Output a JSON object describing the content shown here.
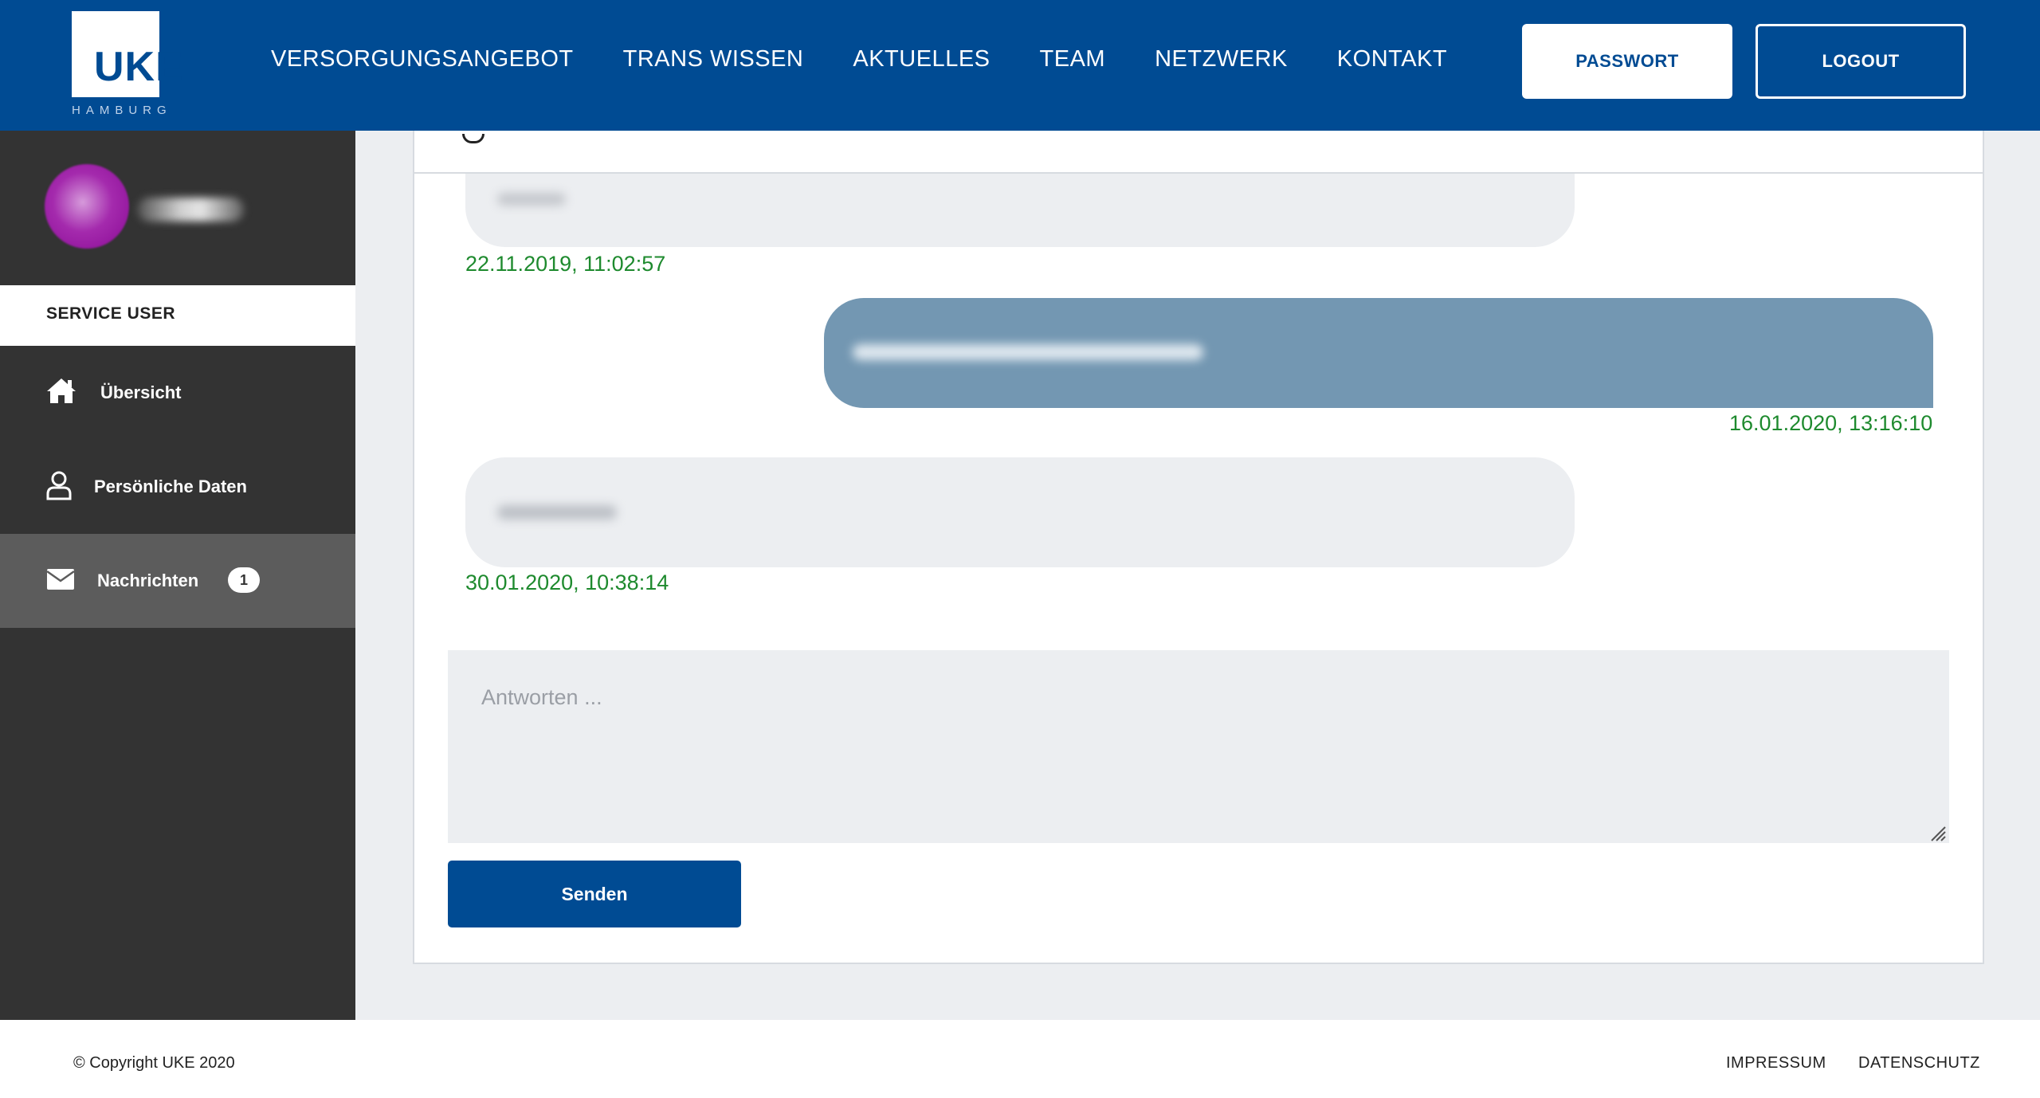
{
  "header": {
    "logo_text": "UKE",
    "logo_sub": "HAMBURG",
    "nav": [
      "VERSORGUNGSANGEBOT",
      "TRANS WISSEN",
      "AKTUELLES",
      "TEAM",
      "NETZWERK",
      "KONTAKT"
    ],
    "password_label": "PASSWORT",
    "logout_label": "LOGOUT"
  },
  "sidebar": {
    "role_label": "SERVICE USER",
    "items": [
      {
        "label": "Übersicht",
        "icon": "home-icon"
      },
      {
        "label": "Persönliche Daten",
        "icon": "user-icon"
      },
      {
        "label": "Nachrichten",
        "icon": "envelope-icon",
        "badge": "1",
        "active": true
      }
    ]
  },
  "messages": [
    {
      "direction": "incoming",
      "timestamp": "22.11.2019, 11:02:57"
    },
    {
      "direction": "outgoing",
      "timestamp": "16.01.2020, 13:16:10"
    },
    {
      "direction": "incoming",
      "timestamp": "30.01.2020, 10:38:14"
    }
  ],
  "reply": {
    "placeholder": "Antworten ...",
    "value": "",
    "send_label": "Senden"
  },
  "footer": {
    "copyright": "© Copyright UKE 2020",
    "links": [
      "IMPRESSUM",
      "DATENSCHUTZ"
    ]
  },
  "colors": {
    "brand_blue": "#004b93",
    "sidebar_bg": "#333333",
    "sidebar_active": "#5c5c5c",
    "timestamp_green": "#1e8a2e",
    "outgoing_bubble": "#7397b2",
    "incoming_bubble": "#eceef1"
  }
}
